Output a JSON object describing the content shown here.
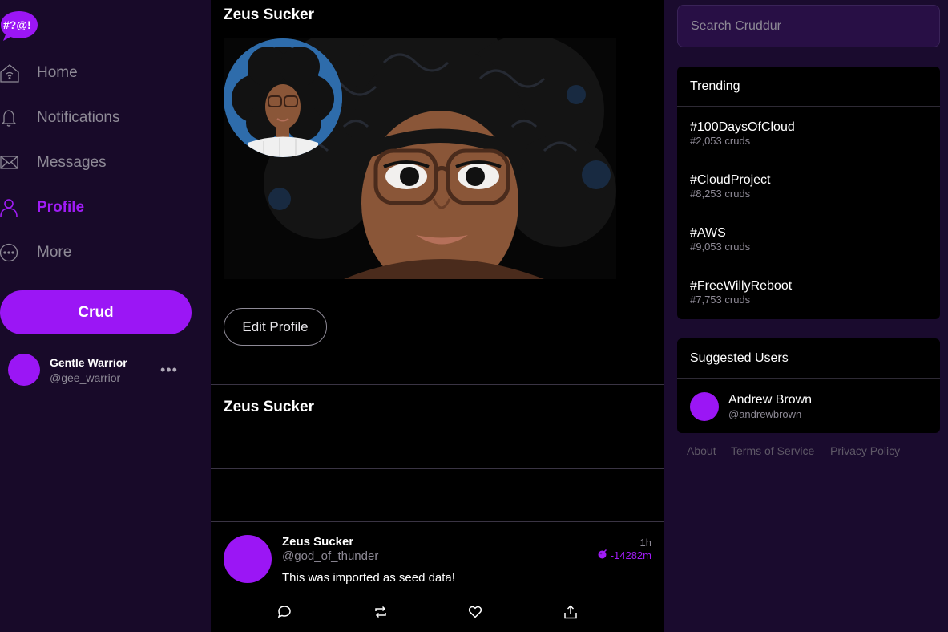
{
  "sidebar": {
    "logo_text": "#?@!",
    "nav": [
      {
        "label": "Home",
        "icon": "home-icon"
      },
      {
        "label": "Notifications",
        "icon": "bell-icon"
      },
      {
        "label": "Messages",
        "icon": "envelope-icon"
      },
      {
        "label": "Profile",
        "icon": "user-icon",
        "active": true
      },
      {
        "label": "More",
        "icon": "more-circle-icon"
      }
    ],
    "crud_button": "Crud",
    "account": {
      "name": "Gentle Warrior",
      "handle": "@gee_warrior",
      "menu": "•••"
    }
  },
  "profile": {
    "name": "Zeus Sucker",
    "edit_button": "Edit Profile",
    "bio_name": "Zeus Sucker"
  },
  "crud": {
    "name": "Zeus Sucker",
    "handle": "@god_of_thunder",
    "time": "1h",
    "expires": "-14282m",
    "text": "This was imported as seed data!",
    "actions": [
      "reply-icon",
      "recrud-icon",
      "like-icon",
      "share-icon"
    ]
  },
  "search": {
    "placeholder": "Search Cruddur"
  },
  "trending": {
    "title": "Trending",
    "items": [
      {
        "name": "#100DaysOfCloud",
        "count": "#2,053 cruds"
      },
      {
        "name": "#CloudProject",
        "count": "#8,253 cruds"
      },
      {
        "name": "#AWS",
        "count": "#9,053 cruds"
      },
      {
        "name": "#FreeWillyReboot",
        "count": "#7,753 cruds"
      }
    ]
  },
  "suggested": {
    "title": "Suggested Users",
    "users": [
      {
        "name": "Andrew Brown",
        "handle": "@andrewbrown"
      }
    ]
  },
  "footer": {
    "links": [
      "About",
      "Terms of Service",
      "Privacy Policy"
    ]
  },
  "colors": {
    "accent": "#9b16f5",
    "background": "#1a0b2e",
    "panel": "#000000"
  }
}
